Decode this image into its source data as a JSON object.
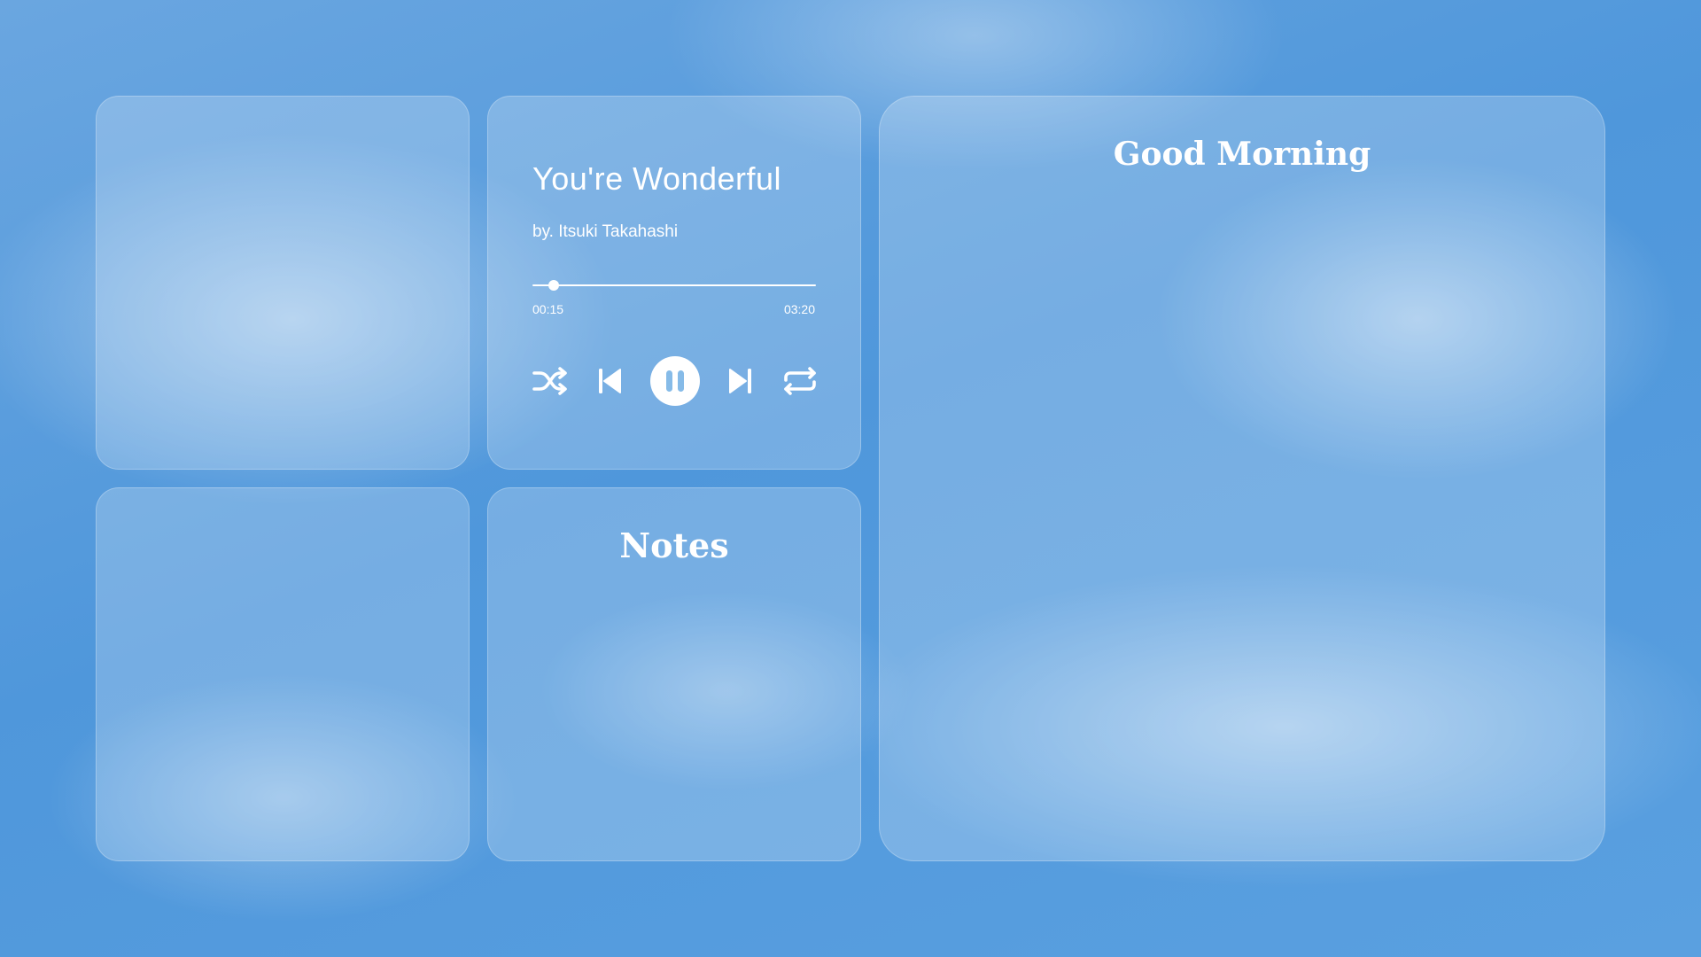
{
  "player": {
    "title": "You're Wonderful",
    "artist": "by. Itsuki Takahashi",
    "elapsed": "00:15",
    "duration": "03:20",
    "progress_fraction": 0.075,
    "state": "playing",
    "controls": {
      "shuffle_icon": "shuffle-icon",
      "previous_icon": "skip-previous-icon",
      "play_pause_icon": "pause-icon",
      "next_icon": "skip-next-icon",
      "repeat_icon": "repeat-icon"
    }
  },
  "notes": {
    "title": "Notes"
  },
  "greeting": {
    "title": "Good Morning"
  },
  "colors": {
    "text": "#ffffff",
    "sky": "#5d9edc",
    "card": "rgba(255,255,255,0.22)"
  }
}
